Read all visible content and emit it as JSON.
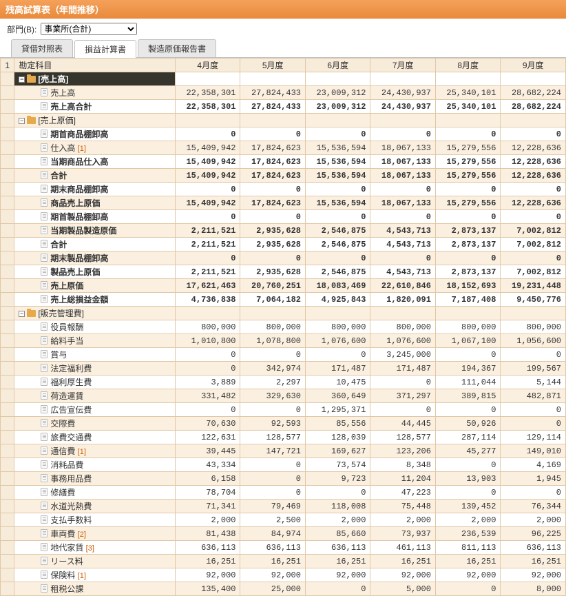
{
  "title": "残高試算表（年間推移）",
  "dept_label": "部門(B):",
  "dept_value": "事業所(合計)",
  "tabs": [
    "貸借対照表",
    "損益計算書",
    "製造原価報告書"
  ],
  "active_tab": 1,
  "corner": "1",
  "account_header": "勘定科目",
  "months": [
    "4月度",
    "5月度",
    "6月度",
    "7月度",
    "8月度",
    "9月度"
  ],
  "rows": [
    {
      "type": "section",
      "lv": 0,
      "label": "[売上高]",
      "v": [
        "",
        "",
        "",
        "",
        "",
        ""
      ]
    },
    {
      "type": "item",
      "lv": 2,
      "label": "売上高",
      "v": [
        "22,358,301",
        "27,824,433",
        "23,009,312",
        "24,430,937",
        "25,340,101",
        "28,682,224"
      ],
      "shade": true
    },
    {
      "type": "item",
      "lv": 2,
      "label": "売上高合計",
      "v": [
        "22,358,301",
        "27,824,433",
        "23,009,312",
        "24,430,937",
        "25,340,101",
        "28,682,224"
      ],
      "bold": true
    },
    {
      "type": "folder",
      "lv": 0,
      "label": "[売上原価]",
      "v": [
        "",
        "",
        "",
        "",
        "",
        ""
      ],
      "shade": true
    },
    {
      "type": "item",
      "lv": 2,
      "label": "期首商品棚卸高",
      "v": [
        "0",
        "0",
        "0",
        "0",
        "0",
        "0"
      ],
      "bold": true
    },
    {
      "type": "item",
      "lv": 2,
      "label": "仕入高",
      "ref": "[1]",
      "v": [
        "15,409,942",
        "17,824,623",
        "15,536,594",
        "18,067,133",
        "15,279,556",
        "12,228,636"
      ],
      "shade": true
    },
    {
      "type": "item",
      "lv": 2,
      "label": "当期商品仕入高",
      "v": [
        "15,409,942",
        "17,824,623",
        "15,536,594",
        "18,067,133",
        "15,279,556",
        "12,228,636"
      ],
      "bold": true
    },
    {
      "type": "item",
      "lv": 2,
      "label": "合計",
      "v": [
        "15,409,942",
        "17,824,623",
        "15,536,594",
        "18,067,133",
        "15,279,556",
        "12,228,636"
      ],
      "bold": true,
      "shade": true
    },
    {
      "type": "item",
      "lv": 2,
      "label": "期末商品棚卸高",
      "v": [
        "0",
        "0",
        "0",
        "0",
        "0",
        "0"
      ],
      "bold": true
    },
    {
      "type": "item",
      "lv": 2,
      "label": "商品売上原価",
      "v": [
        "15,409,942",
        "17,824,623",
        "15,536,594",
        "18,067,133",
        "15,279,556",
        "12,228,636"
      ],
      "bold": true,
      "shade": true
    },
    {
      "type": "item",
      "lv": 2,
      "label": "期首製品棚卸高",
      "v": [
        "0",
        "0",
        "0",
        "0",
        "0",
        "0"
      ],
      "bold": true
    },
    {
      "type": "item",
      "lv": 2,
      "label": "当期製品製造原価",
      "v": [
        "2,211,521",
        "2,935,628",
        "2,546,875",
        "4,543,713",
        "2,873,137",
        "7,002,812"
      ],
      "bold": true,
      "shade": true
    },
    {
      "type": "item",
      "lv": 2,
      "label": "合計",
      "v": [
        "2,211,521",
        "2,935,628",
        "2,546,875",
        "4,543,713",
        "2,873,137",
        "7,002,812"
      ],
      "bold": true
    },
    {
      "type": "item",
      "lv": 2,
      "label": "期末製品棚卸高",
      "v": [
        "0",
        "0",
        "0",
        "0",
        "0",
        "0"
      ],
      "bold": true,
      "shade": true
    },
    {
      "type": "item",
      "lv": 2,
      "label": "製品売上原価",
      "v": [
        "2,211,521",
        "2,935,628",
        "2,546,875",
        "4,543,713",
        "2,873,137",
        "7,002,812"
      ],
      "bold": true
    },
    {
      "type": "item",
      "lv": 2,
      "label": "売上原価",
      "v": [
        "17,621,463",
        "20,760,251",
        "18,083,469",
        "22,610,846",
        "18,152,693",
        "19,231,448"
      ],
      "bold": true,
      "shade": true
    },
    {
      "type": "item",
      "lv": 2,
      "label": "売上総損益金額",
      "v": [
        "4,736,838",
        "7,064,182",
        "4,925,843",
        "1,820,091",
        "7,187,408",
        "9,450,776"
      ],
      "bold": true
    },
    {
      "type": "folder",
      "lv": 0,
      "label": "[販売管理費]",
      "v": [
        "",
        "",
        "",
        "",
        "",
        ""
      ],
      "shade": true
    },
    {
      "type": "item",
      "lv": 2,
      "label": "役員報酬",
      "v": [
        "800,000",
        "800,000",
        "800,000",
        "800,000",
        "800,000",
        "800,000"
      ]
    },
    {
      "type": "item",
      "lv": 2,
      "label": "給料手当",
      "v": [
        "1,010,800",
        "1,078,800",
        "1,076,600",
        "1,076,600",
        "1,067,100",
        "1,056,600"
      ],
      "shade": true
    },
    {
      "type": "item",
      "lv": 2,
      "label": "賞与",
      "v": [
        "0",
        "0",
        "0",
        "3,245,000",
        "0",
        "0"
      ]
    },
    {
      "type": "item",
      "lv": 2,
      "label": "法定福利費",
      "v": [
        "0",
        "342,974",
        "171,487",
        "171,487",
        "194,367",
        "199,567"
      ],
      "shade": true
    },
    {
      "type": "item",
      "lv": 2,
      "label": "福利厚生費",
      "v": [
        "3,889",
        "2,297",
        "10,475",
        "0",
        "111,044",
        "5,144"
      ]
    },
    {
      "type": "item",
      "lv": 2,
      "label": "荷造運賃",
      "v": [
        "331,482",
        "329,630",
        "360,649",
        "371,297",
        "389,815",
        "482,871"
      ],
      "shade": true
    },
    {
      "type": "item",
      "lv": 2,
      "label": "広告宣伝費",
      "v": [
        "0",
        "0",
        "1,295,371",
        "0",
        "0",
        "0"
      ]
    },
    {
      "type": "item",
      "lv": 2,
      "label": "交際費",
      "v": [
        "70,630",
        "92,593",
        "85,556",
        "44,445",
        "50,926",
        "0"
      ],
      "shade": true
    },
    {
      "type": "item",
      "lv": 2,
      "label": "旅費交通費",
      "v": [
        "122,631",
        "128,577",
        "128,039",
        "128,577",
        "287,114",
        "129,114"
      ]
    },
    {
      "type": "item",
      "lv": 2,
      "label": "通信費",
      "ref": "[1]",
      "v": [
        "39,445",
        "147,721",
        "169,627",
        "123,206",
        "45,277",
        "149,010"
      ],
      "shade": true
    },
    {
      "type": "item",
      "lv": 2,
      "label": "消耗品費",
      "v": [
        "43,334",
        "0",
        "73,574",
        "8,348",
        "0",
        "4,169"
      ]
    },
    {
      "type": "item",
      "lv": 2,
      "label": "事務用品費",
      "v": [
        "6,158",
        "0",
        "9,723",
        "11,204",
        "13,903",
        "1,945"
      ],
      "shade": true
    },
    {
      "type": "item",
      "lv": 2,
      "label": "修繕費",
      "v": [
        "78,704",
        "0",
        "0",
        "47,223",
        "0",
        "0"
      ]
    },
    {
      "type": "item",
      "lv": 2,
      "label": "水道光熱費",
      "v": [
        "71,341",
        "79,469",
        "118,008",
        "75,448",
        "139,452",
        "76,344"
      ],
      "shade": true
    },
    {
      "type": "item",
      "lv": 2,
      "label": "支払手数料",
      "v": [
        "2,000",
        "2,500",
        "2,000",
        "2,000",
        "2,000",
        "2,000"
      ]
    },
    {
      "type": "item",
      "lv": 2,
      "label": "車両費",
      "ref": "[2]",
      "v": [
        "81,438",
        "84,974",
        "85,660",
        "73,937",
        "236,539",
        "96,225"
      ],
      "shade": true
    },
    {
      "type": "item",
      "lv": 2,
      "label": "地代家賃",
      "ref": "[3]",
      "v": [
        "636,113",
        "636,113",
        "636,113",
        "461,113",
        "811,113",
        "636,113"
      ]
    },
    {
      "type": "item",
      "lv": 2,
      "label": "リース料",
      "v": [
        "16,251",
        "16,251",
        "16,251",
        "16,251",
        "16,251",
        "16,251"
      ],
      "shade": true
    },
    {
      "type": "item",
      "lv": 2,
      "label": "保険料",
      "ref": "[1]",
      "v": [
        "92,000",
        "92,000",
        "92,000",
        "92,000",
        "92,000",
        "92,000"
      ]
    },
    {
      "type": "item",
      "lv": 2,
      "label": "租税公課",
      "v": [
        "135,400",
        "25,000",
        "0",
        "5,000",
        "0",
        "8,000"
      ],
      "shade": true
    }
  ]
}
